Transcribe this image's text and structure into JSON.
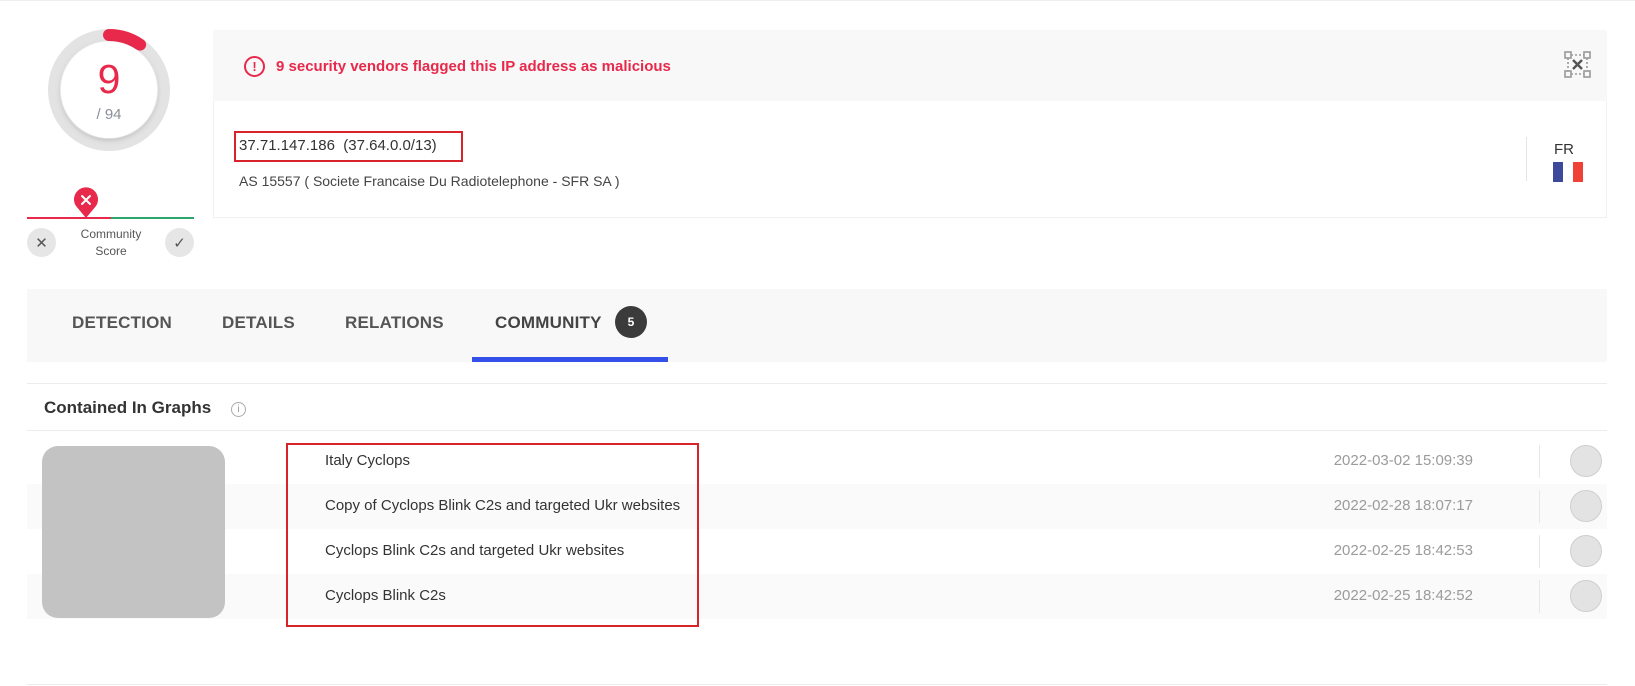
{
  "score": {
    "malicious": "9",
    "total": "/ 94",
    "ratio": 0.0957,
    "color": "#e8294c"
  },
  "community": {
    "label_line1": "Community",
    "label_line2": "Score",
    "dislike_icon": "close-icon",
    "like_icon": "check-icon"
  },
  "alert": {
    "text": "9 security vendors flagged this IP address as malicious",
    "icon": "exclamation-icon",
    "color": "#e8294c"
  },
  "ip": {
    "display": "37.71.147.186  (37.64.0.0/13)",
    "asn": "AS 15557 ( Societe Francaise Du Radiotelephone - SFR SA )",
    "country_code": "FR",
    "flag_colors": [
      "#3d4a9c",
      "#ffffff",
      "#ef4135"
    ]
  },
  "tabs": [
    {
      "label": "DETECTION"
    },
    {
      "label": "DETAILS"
    },
    {
      "label": "RELATIONS"
    },
    {
      "label": "COMMUNITY",
      "badge": "5",
      "active": true
    }
  ],
  "graphs": {
    "title": "Contained In Graphs",
    "info_icon": "info-icon",
    "items": [
      {
        "name": "Italy Cyclops",
        "date": "2022-03-02 15:09:39",
        "icon": "graph-avatar-icon"
      },
      {
        "name": "Copy of Cyclops Blink C2s and targeted Ukr websites",
        "date": "2022-02-28 18:07:17",
        "icon": "graph-avatar-icon"
      },
      {
        "name": "Cyclops Blink C2s and targeted Ukr websites",
        "date": "2022-02-25 18:42:53",
        "icon": "graph-avatar-icon"
      },
      {
        "name": "Cyclops Blink C2s",
        "date": "2022-02-25 18:42:52",
        "icon": "graph-avatar-icon"
      }
    ]
  },
  "colors": {
    "accent_blue": "#3450e8",
    "highlight_box": "#d8232a",
    "positive_green": "#2aa56b"
  }
}
